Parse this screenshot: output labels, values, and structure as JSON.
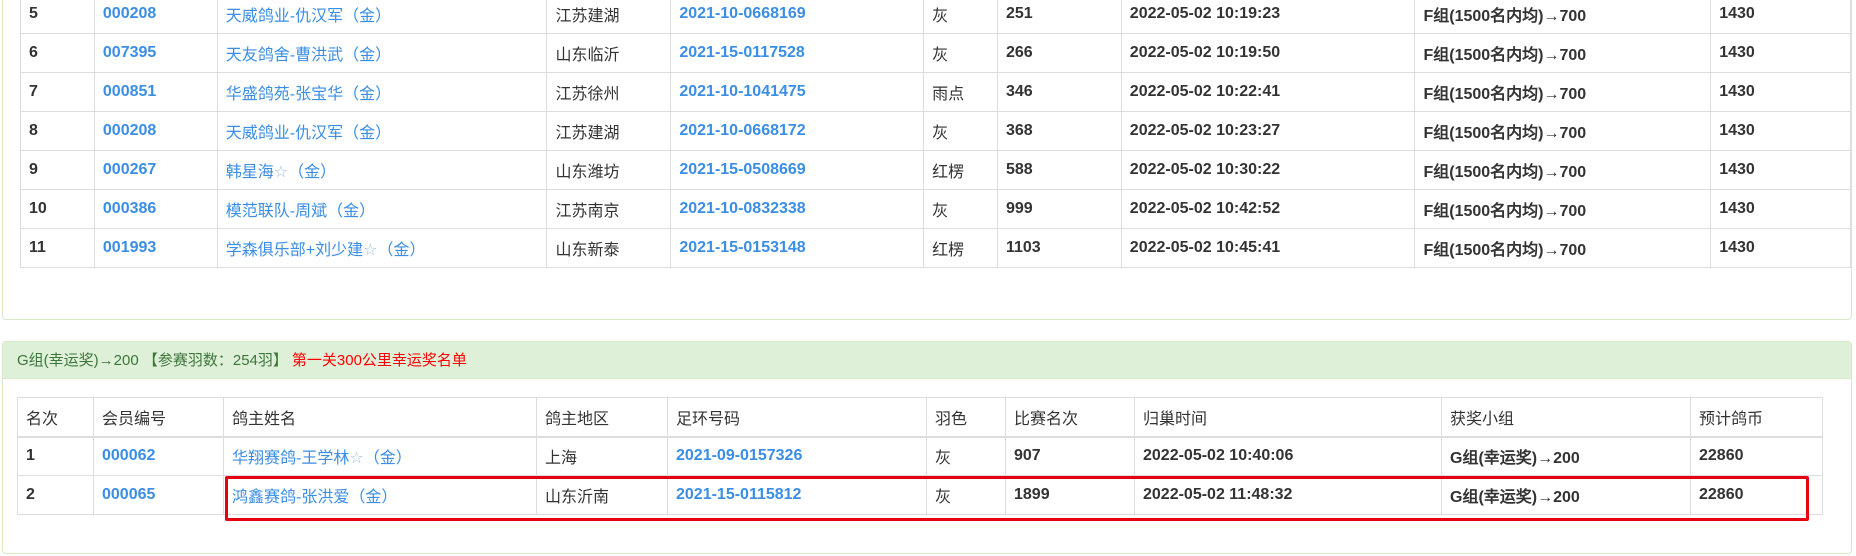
{
  "top_table": {
    "rows": [
      {
        "rank": "5",
        "member_id": "000208",
        "owner": "天威鸽业-仇汉军（金）",
        "region": "江苏建湖",
        "ring": "2021-10-0668169",
        "color": "灰",
        "place": "251",
        "time": "2022-05-02 10:19:23",
        "group": "F组(1500名内均)→700",
        "coins": "1430"
      },
      {
        "rank": "6",
        "member_id": "007395",
        "owner": "天友鸽舍-曹洪武（金）",
        "region": "山东临沂",
        "ring": "2021-15-0117528",
        "color": "灰",
        "place": "266",
        "time": "2022-05-02 10:19:50",
        "group": "F组(1500名内均)→700",
        "coins": "1430"
      },
      {
        "rank": "7",
        "member_id": "000851",
        "owner": "华盛鸽苑-张宝华（金）",
        "region": "江苏徐州",
        "ring": "2021-10-1041475",
        "color": "雨点",
        "place": "346",
        "time": "2022-05-02 10:22:41",
        "group": "F组(1500名内均)→700",
        "coins": "1430"
      },
      {
        "rank": "8",
        "member_id": "000208",
        "owner": "天威鸽业-仇汉军（金）",
        "region": "江苏建湖",
        "ring": "2021-10-0668172",
        "color": "灰",
        "place": "368",
        "time": "2022-05-02 10:23:27",
        "group": "F组(1500名内均)→700",
        "coins": "1430"
      },
      {
        "rank": "9",
        "member_id": "000267",
        "owner": "韩星海",
        "owner_star": "☆",
        "owner_suffix": "（金）",
        "region": "山东潍坊",
        "ring": "2021-15-0508669",
        "color": "红楞",
        "place": "588",
        "time": "2022-05-02 10:30:22",
        "group": "F组(1500名内均)→700",
        "coins": "1430"
      },
      {
        "rank": "10",
        "member_id": "000386",
        "owner": "模范联队-周斌（金）",
        "region": "江苏南京",
        "ring": "2021-10-0832338",
        "color": "灰",
        "place": "999",
        "time": "2022-05-02 10:42:52",
        "group": "F组(1500名内均)→700",
        "coins": "1430"
      },
      {
        "rank": "11",
        "member_id": "001993",
        "owner": "学森俱乐部+刘少建",
        "owner_star": "☆",
        "owner_suffix": "（金）",
        "region": "山东新泰",
        "ring": "2021-15-0153148",
        "color": "红楞",
        "place": "1103",
        "time": "2022-05-02 10:45:41",
        "group": "F组(1500名内均)→700",
        "coins": "1430"
      }
    ]
  },
  "bottom_panel": {
    "heading": "G组(幸运奖)→200 【参赛羽数：254羽】",
    "heading_link": "第一关300公里幸运奖名单",
    "columns": [
      "名次",
      "会员编号",
      "鸽主姓名",
      "鸽主地区",
      "足环号码",
      "羽色",
      "比赛名次",
      "归巢时间",
      "获奖小组",
      "预计鸽币"
    ],
    "rows": [
      {
        "rank": "1",
        "member_id": "000062",
        "owner": "华翔赛鸽-王学林",
        "owner_star": "☆",
        "owner_suffix": "（金）",
        "region": "上海",
        "ring": "2021-09-0157326",
        "color": "灰",
        "place": "907",
        "time": "2022-05-02 10:40:06",
        "group": "G组(幸运奖)→200",
        "coins": "22860"
      },
      {
        "rank": "2",
        "member_id": "000065",
        "owner": "鸿鑫赛鸽-张洪爱（金）",
        "region": "山东沂南",
        "ring": "2021-15-0115812",
        "color": "灰",
        "place": "1899",
        "time": "2022-05-02 11:48:32",
        "group": "G组(幸运奖)→200",
        "coins": "22860"
      }
    ]
  },
  "colors": {
    "link_blue": "#3a8ee6",
    "heading_bg": "#dff0d8",
    "heading_text": "#3c763d",
    "highlight_red": "#e60012"
  }
}
